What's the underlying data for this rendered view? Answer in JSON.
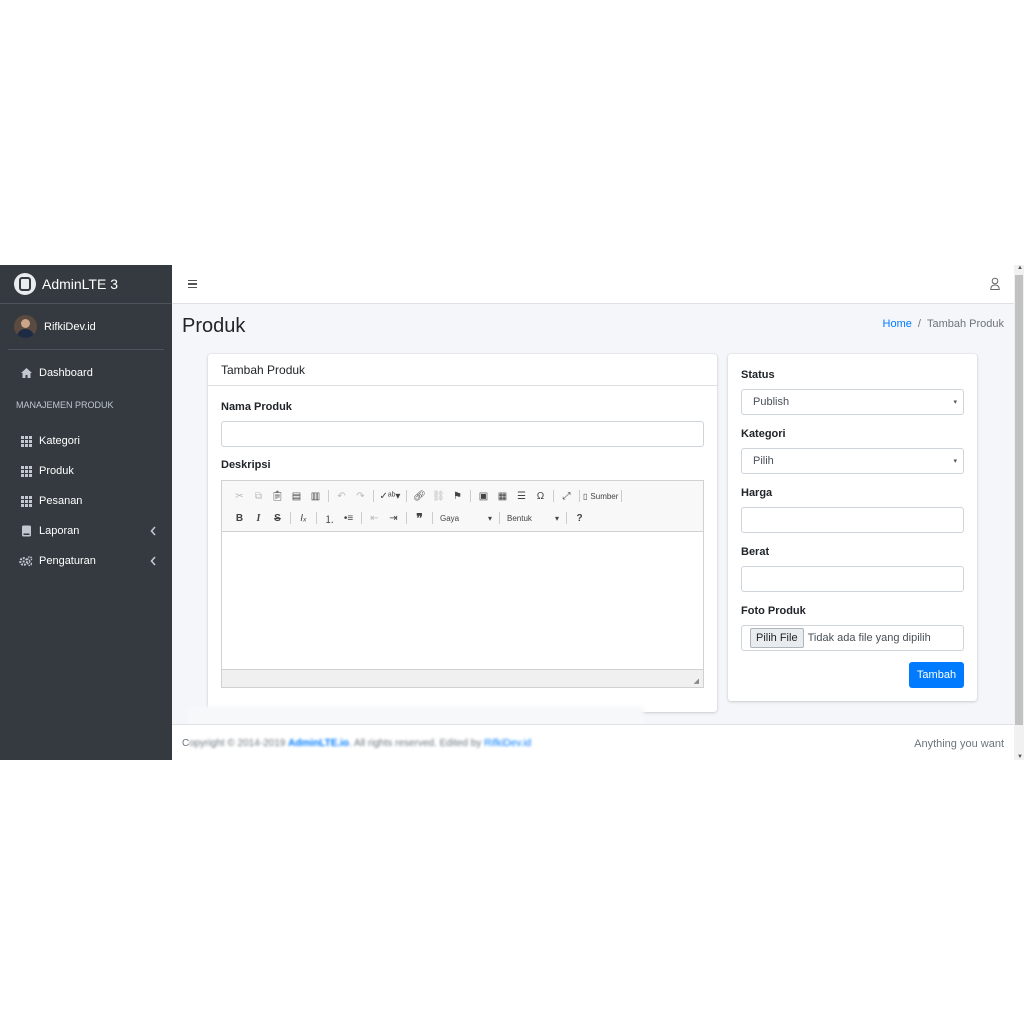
{
  "brand": {
    "name": "AdminLTE 3"
  },
  "user": {
    "name": "RifkiDev.id"
  },
  "sidebar": {
    "items_top": [
      {
        "label": "Dashboard",
        "icon": "home-icon"
      }
    ],
    "section_header": "MANAJEMEN PRODUK",
    "items": [
      {
        "label": "Kategori",
        "icon": "grid-icon"
      },
      {
        "label": "Produk",
        "icon": "grid-icon"
      },
      {
        "label": "Pesanan",
        "icon": "grid-icon"
      },
      {
        "label": "Laporan",
        "icon": "book-icon",
        "has_children": true
      },
      {
        "label": "Pengaturan",
        "icon": "cogs-icon",
        "has_children": true
      }
    ]
  },
  "page": {
    "title": "Produk",
    "breadcrumb": {
      "home": "Home",
      "separator": "/",
      "current": "Tambah Produk"
    }
  },
  "form": {
    "card_title": "Tambah Produk",
    "nama_label": "Nama Produk",
    "nama_value": "",
    "deskripsi_label": "Deskripsi",
    "editor": {
      "source_label": "Sumber",
      "style_combo": "Gaya",
      "format_combo": "Bentuk"
    }
  },
  "side_form": {
    "status_label": "Status",
    "status_value": "Publish",
    "kategori_label": "Kategori",
    "kategori_value": "Pilih",
    "harga_label": "Harga",
    "harga_value": "",
    "berat_label": "Berat",
    "berat_value": "",
    "foto_label": "Foto Produk",
    "file_button": "Pilih File",
    "file_status": "Tidak ada file yang dipilih",
    "submit": "Tambah"
  },
  "footer": {
    "copyright_start": "C",
    "copyright_rest": "opyright © 2014-2019",
    "brand_link": "AdminLTE.io",
    "rights": ". All rights reserved. Edited by",
    "edited_link": "RifkiDev.id",
    "right_text": "Anything you want"
  },
  "colors": {
    "sidebar": "#343a40",
    "primary": "#007bff",
    "background": "#f4f6f9"
  }
}
